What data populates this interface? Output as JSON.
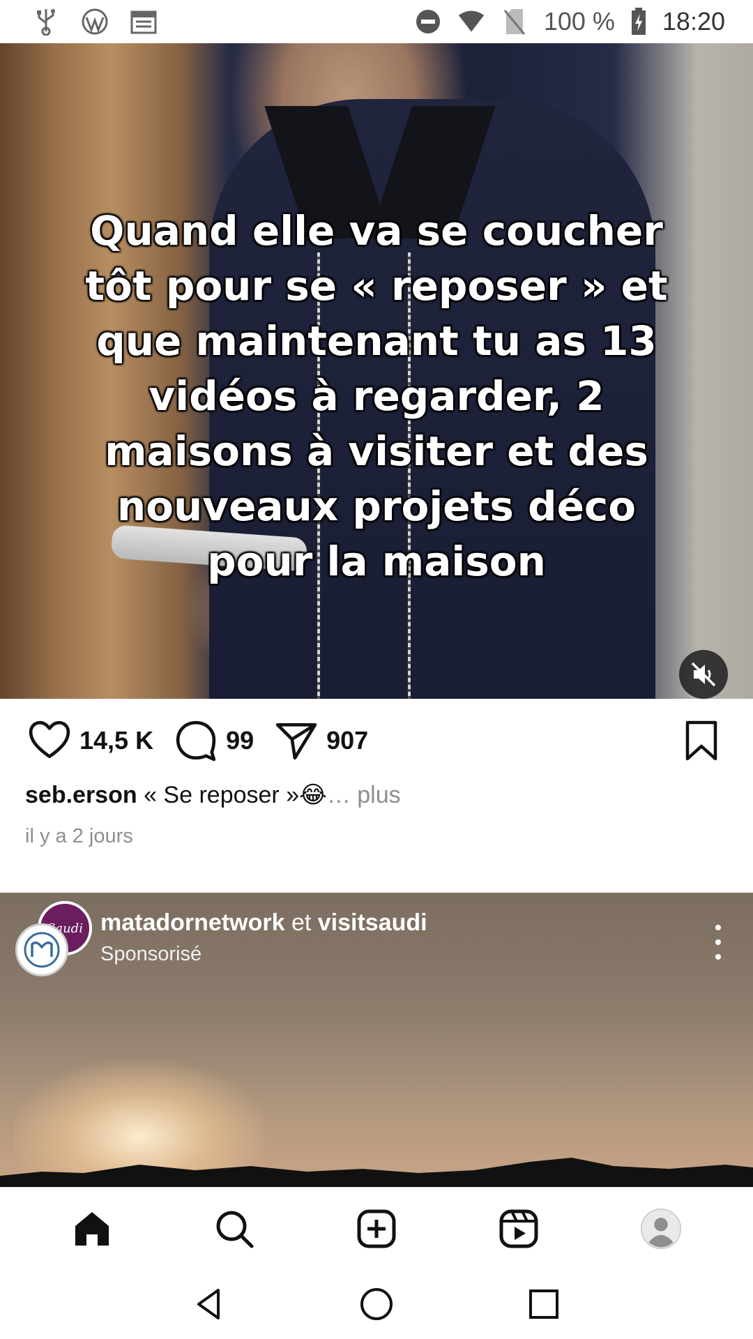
{
  "status_bar": {
    "battery": "100 %",
    "time": "18:20",
    "left_icons": [
      "usb-icon",
      "wordpress-icon",
      "calendar-icon"
    ],
    "right_icons": [
      "do-not-disturb-icon",
      "wifi-icon",
      "no-sim-icon",
      "battery-charging-icon"
    ]
  },
  "post": {
    "overlay_text": "Quand elle va se coucher\ntôt pour se « reposer » et\nque maintenant tu as 13\nvidéos à regarder, 2\nmaisons à visiter et des\nnouveaux projets déco\npour la maison",
    "likes": "14,5 K",
    "comments": "99",
    "shares": "907",
    "username": "seb.erson",
    "caption": " « Se reposer »😂",
    "more": "… plus",
    "time_ago": "il y a 2 jours",
    "muted": true
  },
  "sponsored_post": {
    "account1": "matadornetwork",
    "joiner": " et ",
    "account2": "visitsaudi",
    "label": "Sponsorisé",
    "avatar_text": "Saudi"
  },
  "bottom_nav": {
    "items": [
      "home-icon",
      "search-icon",
      "create-icon",
      "reels-icon",
      "profile-icon"
    ],
    "active": "home-icon"
  },
  "system_nav": {
    "items": [
      "back-icon",
      "home-circle-icon",
      "recents-icon"
    ]
  }
}
